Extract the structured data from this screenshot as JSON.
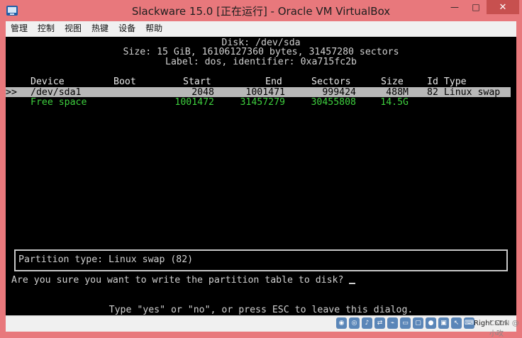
{
  "window": {
    "title": "Slackware 15.0 [正在运行] - Oracle VM VirtualBox",
    "minimize": "—",
    "maximize": "□",
    "close": "✕"
  },
  "menu": {
    "items": [
      "管理",
      "控制",
      "视图",
      "热键",
      "设备",
      "帮助"
    ]
  },
  "terminal": {
    "disk_title": "Disk: /dev/sda",
    "size_line": "Size: 15 GiB, 16106127360 bytes, 31457280 sectors",
    "label_line": "Label: dos, identifier: 0xa715fc2b",
    "columns": {
      "device": "Device",
      "boot": "Boot",
      "start": "Start",
      "end": "End",
      "sectors": "Sectors",
      "size": "Size",
      "id_type": "Id Type"
    },
    "rows": [
      {
        "marker": ">>",
        "device": "/dev/sda1",
        "boot": "",
        "start": "2048",
        "end": "1001471",
        "sectors": "999424",
        "size": "488M",
        "id_type": "82 Linux swap"
      },
      {
        "marker": "",
        "device": "Free space",
        "boot": "",
        "start": "1001472",
        "end": "31457279",
        "sectors": "30455808",
        "size": "14.5G",
        "id_type": ""
      }
    ],
    "partition_type": "Partition type: Linux swap (82)",
    "question": "Are you sure you want to write the partition table to disk?",
    "hint": "Type \"yes\" or \"no\", or press ESC to leave this dialog."
  },
  "statusbar": {
    "hostkey": "Right Ctrl",
    "watermark": "CSDN @小吹"
  },
  "colors": {
    "titlebar": "#e8787c",
    "close_button": "#c7504f",
    "terminal_bg": "#000000",
    "selection_bg": "#b8b8b8",
    "free_space": "#3ecf3e"
  }
}
